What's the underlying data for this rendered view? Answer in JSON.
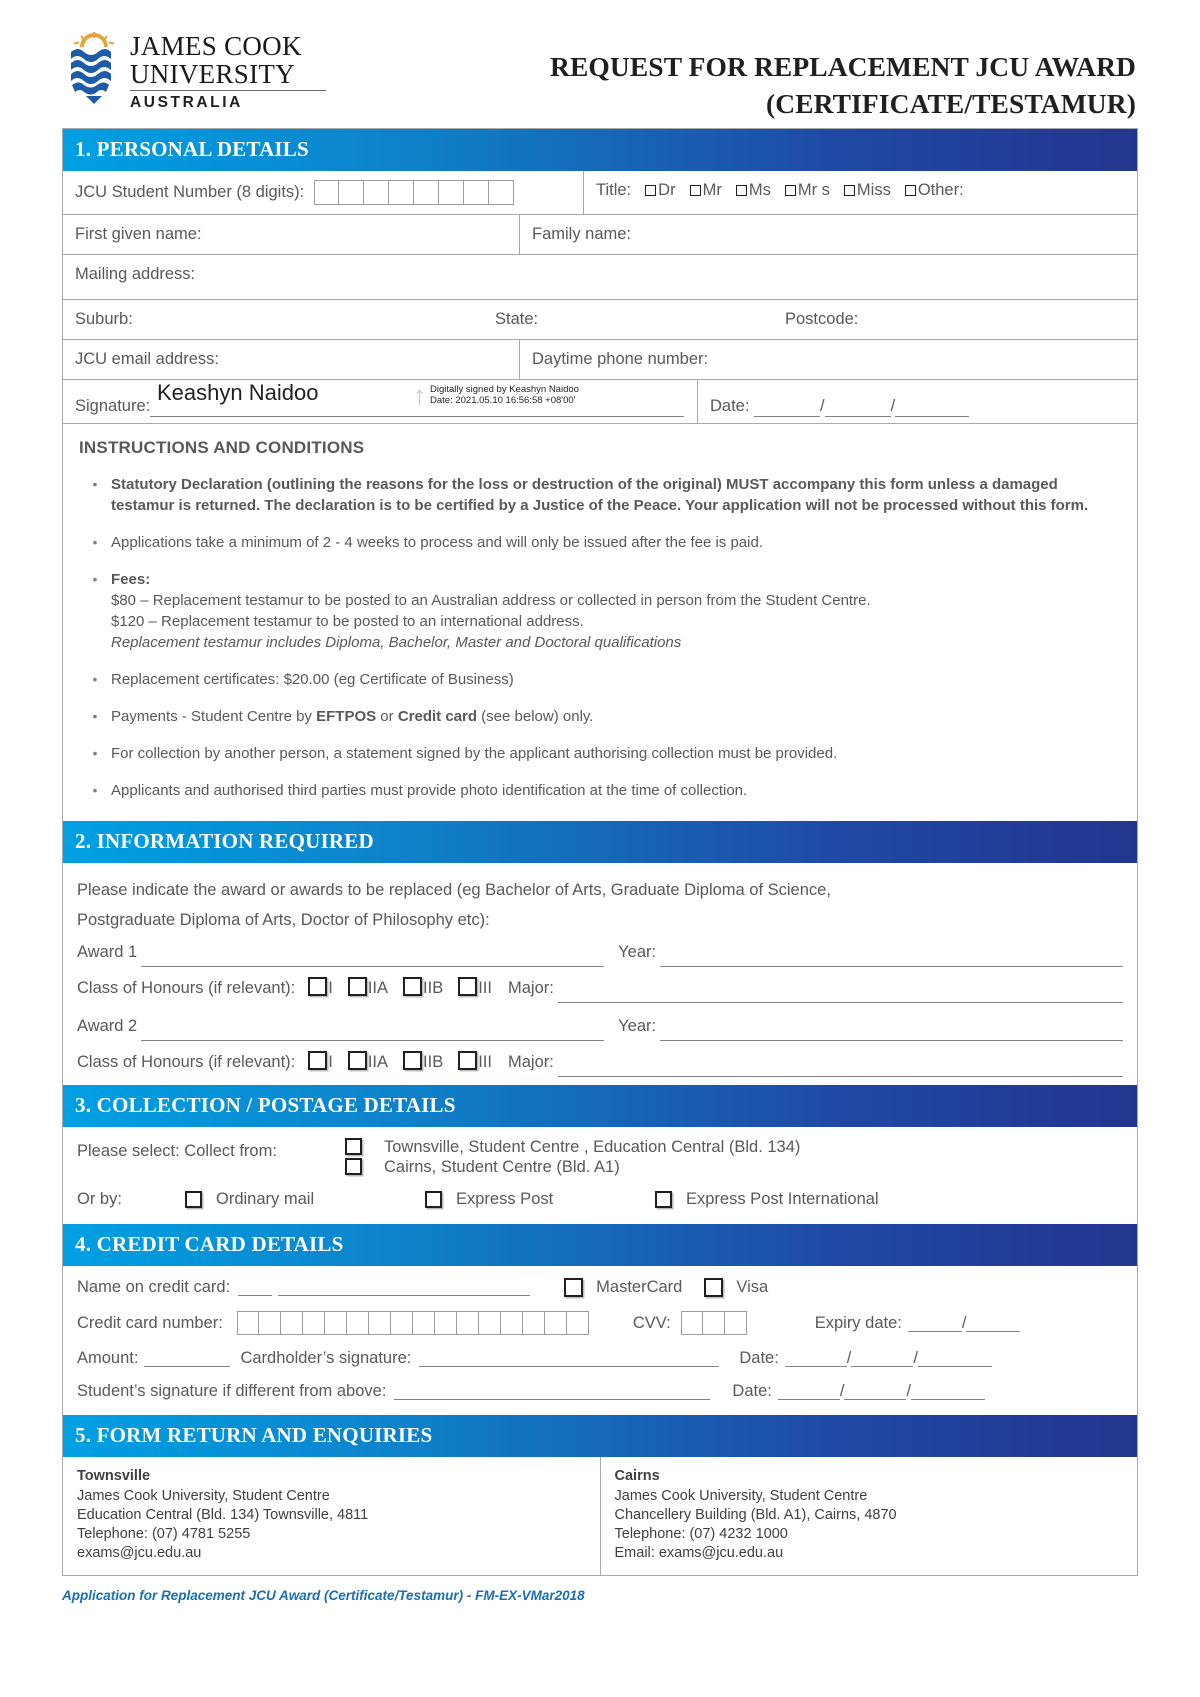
{
  "logo": {
    "line1": "JAMES COOK",
    "line2": "UNIVERSITY",
    "sub": "AUSTRALIA"
  },
  "header": {
    "title_line1": "REQUEST FOR REPLACEMENT JCU AWARD",
    "title_line2": "(CERTIFICATE/TESTAMUR)"
  },
  "section1": {
    "heading": "1.  PERSONAL DETAILS",
    "student_number_label": "JCU Student Number (8 digits):",
    "student_number_digits": 8,
    "title_label": "Title:",
    "title_options": [
      "Dr",
      "Mr",
      "Ms",
      "Mr s",
      "Miss",
      "Other:"
    ],
    "first_name_label": "First given name:",
    "family_name_label": "Family name:",
    "mailing_address_label": "Mailing address:",
    "suburb_label": "Suburb:",
    "state_label": "State:",
    "postcode_label": "Postcode:",
    "email_label": "JCU email address:",
    "phone_label": "Daytime phone number:",
    "signature_label": "Signature:",
    "signature_value": "Keashyn Naidoo",
    "signature_meta_line1": "Digitally signed by Keashyn Naidoo",
    "signature_meta_line2": "Date: 2021.05.10 16:56:58 +08'00'",
    "date_label": "Date:",
    "date_separator": "/"
  },
  "instructions": {
    "heading": "INSTRUCTIONS AND CONDITIONS",
    "items": [
      {
        "bold_prefix": "",
        "text": "Statutory Declaration (outlining the reasons for the loss or destruction of the original) MUST accompany this form unless a damaged testamur is returned. The declaration is to be certified by a Justice of the Peace.  Your application will not be processed without this form.",
        "style": "bold"
      },
      {
        "text": "Applications take a minimum of 2 - 4 weeks to process and will only be issued after the fee is paid.",
        "style": "normal"
      },
      {
        "label": "Fees:",
        "line1": "$80 – Replacement testamur to be posted to an Australian address or collected in person from the Student Centre.",
        "line2": "$120 – Replacement testamur to be posted to an international address.",
        "line3": "Replacement testamur includes Diploma, Bachelor, Master and Doctoral qualifications",
        "style": "fees"
      },
      {
        "text": "Replacement certificates: $20.00 (eg Certificate of Business)",
        "style": "normal"
      },
      {
        "pre": "Payments - Student Centre by ",
        "b1": "EFTPOS",
        "mid": " or ",
        "b2": "Credit card",
        "post": " (see below) only.",
        "style": "payments"
      },
      {
        "text": "For collection by another person, a statement signed by the applicant authorising collection must be provided.",
        "style": "normal"
      },
      {
        "text": "Applicants and authorised third parties must provide photo identification at the time of collection.",
        "style": "normal"
      }
    ]
  },
  "section2": {
    "heading": "2. INFORMATION REQUIRED",
    "intro_line1": "Please indicate the award or awards to be replaced (eg Bachelor of Arts, Graduate Diploma of Science,",
    "intro_line2": "Postgraduate Diploma of Arts, Doctor of Philosophy etc):",
    "award1_label": "Award 1",
    "award2_label": "Award 2",
    "year_label": "Year:",
    "honours_label": "Class of Honours (if relevant):",
    "honours_options": [
      "I",
      "IIA",
      "IIB",
      "III"
    ],
    "major_label": "Major:"
  },
  "section3": {
    "heading": "3. COLLECTION / POSTAGE DETAILS",
    "select_label": "Please select: Collect from:",
    "collect_options": [
      "Townsville, Student Centre , Education Central (Bld. 134)",
      "Cairns, Student Centre (Bld. A1)"
    ],
    "orby_label": "Or by:",
    "postage_options": [
      "Ordinary mail",
      "Express Post",
      "Express Post International"
    ]
  },
  "section4": {
    "heading": "4. CREDIT CARD DETAILS",
    "name_label": "Name on credit card:",
    "card_types": [
      "MasterCard",
      "Visa"
    ],
    "card_number_label": "Credit card number:",
    "card_number_digits": 16,
    "cvv_label": "CVV:",
    "cvv_digits": 3,
    "expiry_label": "Expiry date:",
    "amount_label": "Amount:",
    "cardholder_sig_label": "Cardholder’s signature:",
    "date_label": "Date:",
    "student_sig_label": "Student’s signature if different from above:"
  },
  "section5": {
    "heading": "5. FORM RETURN AND ENQUIRIES",
    "townsville": {
      "city": "Townsville",
      "line1": "James Cook University, Student Centre",
      "line2": "Education Central (Bld. 134) Townsville, 4811",
      "line3": "Telephone: (07) 4781 5255",
      "line4": "exams@jcu.edu.au"
    },
    "cairns": {
      "city": "Cairns",
      "line1": "James Cook University, Student Centre",
      "line2": "Chancellery Building (Bld. A1), Cairns, 4870",
      "line3": "Telephone: (07) 4232 1000",
      "line4": "Email: exams@jcu.edu.au"
    }
  },
  "footer": {
    "text": "Application for Replacement JCU Award (Certificate/Testamur) - FM-EX-VMar2018"
  },
  "colors": {
    "bar_start": "#00a0e3",
    "bar_end": "#23358f",
    "crest_blue": "#1f5ca8",
    "crest_gold": "#e8a33d",
    "footer_blue": "#1a6fb5",
    "text_grey": "#58595b"
  }
}
